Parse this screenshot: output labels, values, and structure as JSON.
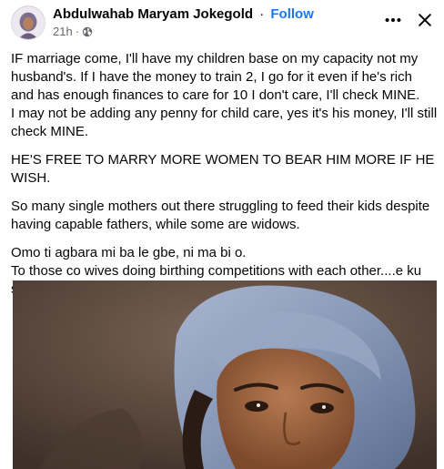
{
  "post": {
    "author": "Abdulwahab Maryam Jokegold",
    "separator": "·",
    "follow_label": "Follow",
    "timestamp": "21h",
    "meta_separator": "·",
    "privacy_icon": "globe-icon",
    "more_icon": "more-horizontal-icon",
    "close_icon": "close-icon",
    "paragraphs": [
      {
        "lines": [
          "IF marriage come, I'll have my children base on my capacity not my husband's. If I have the money to train 2, I go for it even if he's rich and has enough finances to care for 10 I don't care, I'll check MINE.",
          "I may not be adding any penny for child care, yes it's his money, I'll still check MINE."
        ]
      },
      {
        "lines": [
          "HE'S FREE TO MARRY MORE WOMEN TO BEAR HIM MORE IF HE WISH."
        ]
      },
      {
        "lines": [
          "So many single mothers out there struggling to feed their kids despite having capable fathers, while some are widows."
        ]
      },
      {
        "lines": [
          "Omo ti agbara mi ba le gbe, ni ma bi o.",
          "To those co wives doing birthing competitions with each other....e ku se oo... hope Una dey get backups?"
        ]
      }
    ]
  },
  "colors": {
    "link": "#1877f2",
    "text": "#050505",
    "meta": "#65676b",
    "headwrap": "#8a9bb8"
  }
}
